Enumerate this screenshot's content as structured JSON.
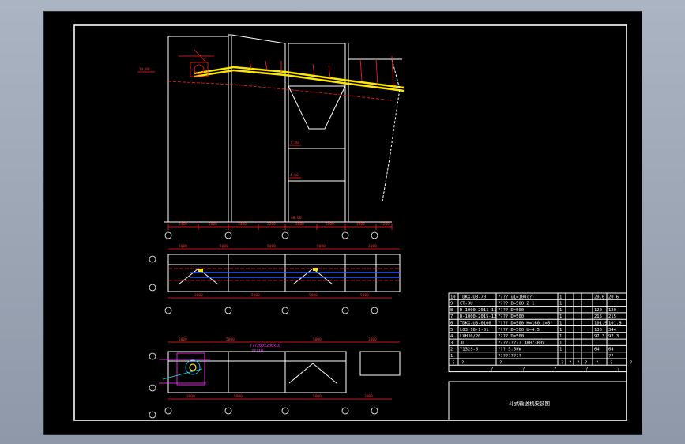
{
  "drawing": {
    "title_block": {
      "title": "斗式输送机安装图"
    },
    "elevation_top": {
      "level_left": "14.00",
      "level_mid_1": "7.50",
      "level_mid_2": "4.50",
      "level_bottom": "±0.00",
      "dims": [
        "2400",
        "5000",
        "3400",
        "3200",
        "3000",
        "5000",
        "3000",
        "1200"
      ]
    },
    "plan_middle": {
      "dims_top": [
        "3000",
        "5000",
        "5000",
        "5000",
        "3000"
      ],
      "dims_bottom": [
        "3000",
        "5000",
        "5000",
        "5000",
        "3000"
      ]
    },
    "plan_bottom": {
      "label_size": "???200x200x10",
      "label_sub": "???10",
      "dims_top": [
        "3000",
        "5000",
        "5000",
        "3000"
      ],
      "dims_bottom": [
        "3000",
        "5000",
        "5000",
        "3000"
      ]
    },
    "bom_rows": [
      {
        "no": "10",
        "code": "TDKX-U3-70",
        "desc": "???? u1=100(?)",
        "qty": "1",
        "unit": "",
        "w1": "20.6",
        "w2": "20.6"
      },
      {
        "no": "9",
        "code": "CT-3U",
        "desc": "???? B=500 2~1",
        "qty": "1",
        "unit": "",
        "w1": "",
        "w2": ""
      },
      {
        "no": "8",
        "code": "D-1000-2011-11",
        "desc": "???? D=500",
        "qty": "1",
        "unit": "",
        "w1": "120",
        "w2": "120"
      },
      {
        "no": "7",
        "code": "D-1000-2015-12",
        "desc": "???? D=500",
        "qty": "1",
        "unit": "",
        "w1": "215",
        "w2": "215"
      },
      {
        "no": "6",
        "code": "TDKX-U3-0100",
        "desc": "???? D=500 H=160 i=6°",
        "qty": "1",
        "unit": "",
        "w1": "101.9",
        "w2": "101.9"
      },
      {
        "no": "5",
        "code": "L03-16-1-01",
        "desc": "???? D=500 U=4.5",
        "qty": "1",
        "unit": "",
        "w1": "136",
        "w2": "344"
      },
      {
        "no": "4",
        "code": "LXHJ0/20",
        "desc": "???? D=500",
        "qty": "1",
        "unit": "",
        "w1": "97.3",
        "w2": "97.3"
      },
      {
        "no": "3",
        "code": "JL",
        "desc": "????????? 380/380V",
        "qty": "1",
        "unit": "",
        "w1": "",
        "w2": ""
      },
      {
        "no": "2",
        "code": "Y132S-6",
        "desc": "??? 5.5kW",
        "qty": "1",
        "unit": "",
        "w1": "64",
        "w2": "64"
      },
      {
        "no": "1",
        "code": "",
        "desc": "?????????",
        "qty": "",
        "unit": "",
        "w1": "",
        "w2": "??"
      }
    ],
    "bom_header": [
      "?",
      "?",
      "?",
      "?",
      "?",
      "?",
      "?",
      "?",
      "?",
      "?"
    ],
    "bom_header_2": [
      "?",
      "?",
      "?",
      "?",
      "?"
    ]
  }
}
